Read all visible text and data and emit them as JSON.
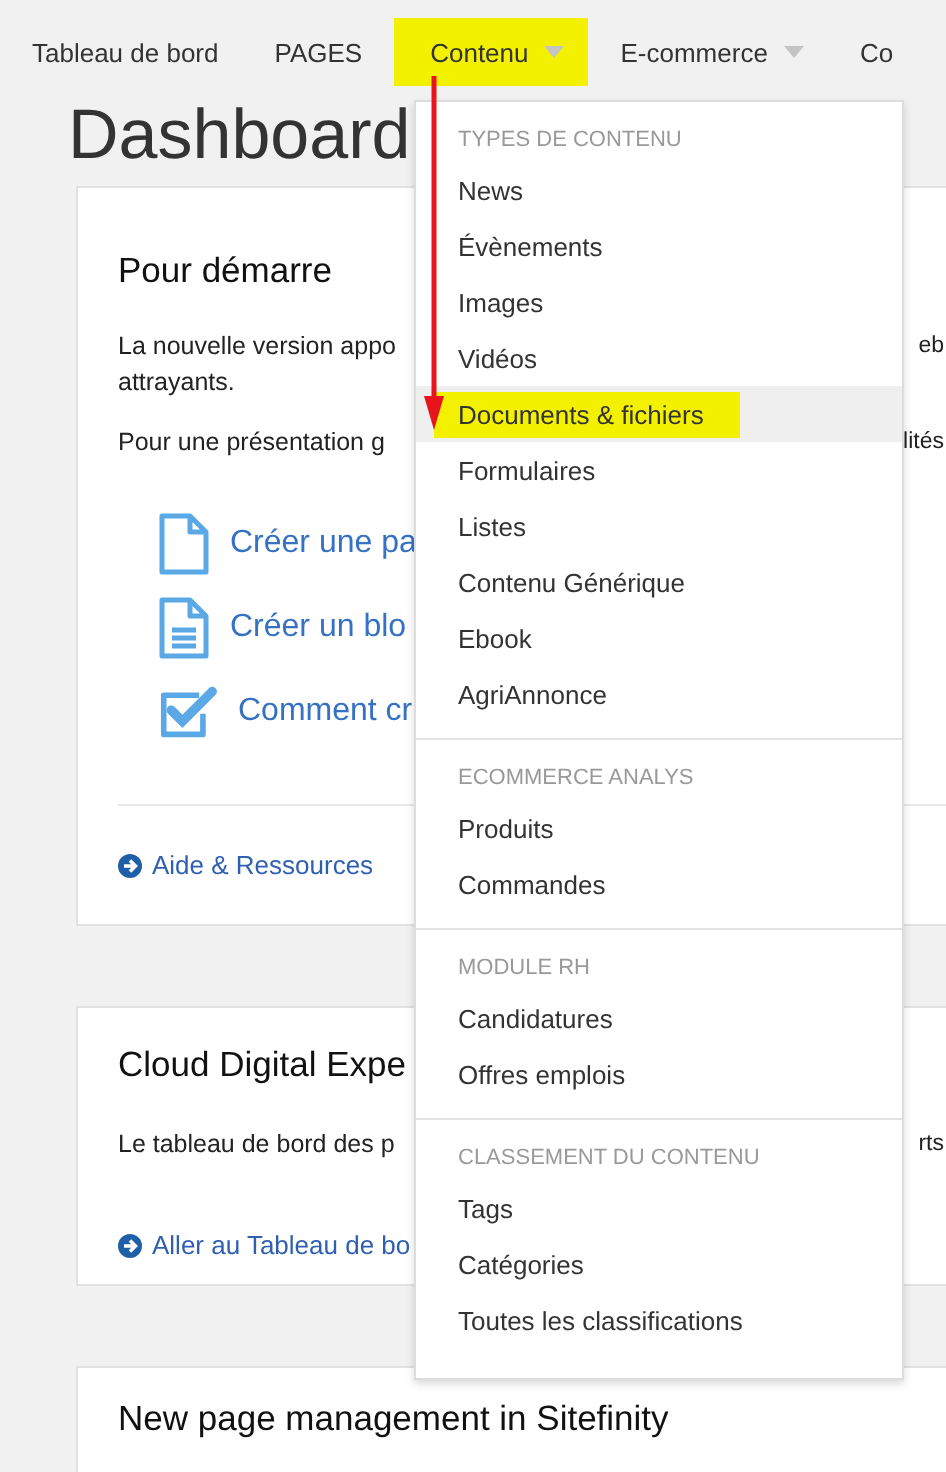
{
  "nav": [
    {
      "label": "Tableau de bord",
      "selected": false,
      "dropdown": false
    },
    {
      "label": "PAGES",
      "selected": false,
      "dropdown": false
    },
    {
      "label": "Contenu",
      "selected": true,
      "dropdown": true
    },
    {
      "label": "E-commerce",
      "selected": false,
      "dropdown": true
    },
    {
      "label": "Co",
      "selected": false,
      "dropdown": false
    }
  ],
  "page_title": "Dashboard",
  "cards": [
    {
      "title": "Pour démarre",
      "paragraphs": [
        {
          "lines": [
            {
              "left": "La nouvelle version appo",
              "right": "eb"
            },
            {
              "left": "attrayants."
            }
          ]
        },
        {
          "lines": [
            {
              "left": "Pour une présentation g",
              "right": "lités"
            }
          ]
        }
      ],
      "links": [
        {
          "kind": "page",
          "label": "Créer une pa"
        },
        {
          "kind": "post",
          "label": "Créer un blo"
        },
        {
          "kind": "check",
          "label": "Comment cr"
        }
      ],
      "footer_link": "Aide & Ressources"
    },
    {
      "title": "Cloud Digital Expe",
      "paragraphs": [
        {
          "lines": [
            {
              "left": "Le tableau de bord des p",
              "right": "rts"
            }
          ]
        }
      ],
      "footer_link": "Aller au Tableau de bo"
    },
    {
      "title": "New page management in Sitefinity"
    }
  ],
  "menu": [
    {
      "heading": "TYPES DE CONTENU",
      "items": [
        {
          "label": "News",
          "highlighted": false
        },
        {
          "label": "Évènements",
          "highlighted": false
        },
        {
          "label": "Images",
          "highlighted": false
        },
        {
          "label": "Vidéos",
          "highlighted": false
        },
        {
          "label": "Documents & fichiers",
          "highlighted": true
        },
        {
          "label": "Formulaires",
          "highlighted": false
        },
        {
          "label": "Listes",
          "highlighted": false
        },
        {
          "label": "Contenu Générique",
          "highlighted": false
        },
        {
          "label": "Ebook",
          "highlighted": false
        },
        {
          "label": "AgriAnnonce",
          "highlighted": false
        }
      ]
    },
    {
      "heading": "ECOMMERCE ANALYS",
      "items": [
        {
          "label": "Produits",
          "highlighted": false
        },
        {
          "label": "Commandes",
          "highlighted": false
        }
      ]
    },
    {
      "heading": "MODULE RH",
      "items": [
        {
          "label": "Candidatures",
          "highlighted": false
        },
        {
          "label": "Offres emplois",
          "highlighted": false
        }
      ]
    },
    {
      "heading": "CLASSEMENT DU CONTENU",
      "items": [
        {
          "label": "Tags",
          "highlighted": false
        },
        {
          "label": "Catégories",
          "highlighted": false
        },
        {
          "label": "Toutes les classifications",
          "highlighted": false
        }
      ]
    }
  ]
}
